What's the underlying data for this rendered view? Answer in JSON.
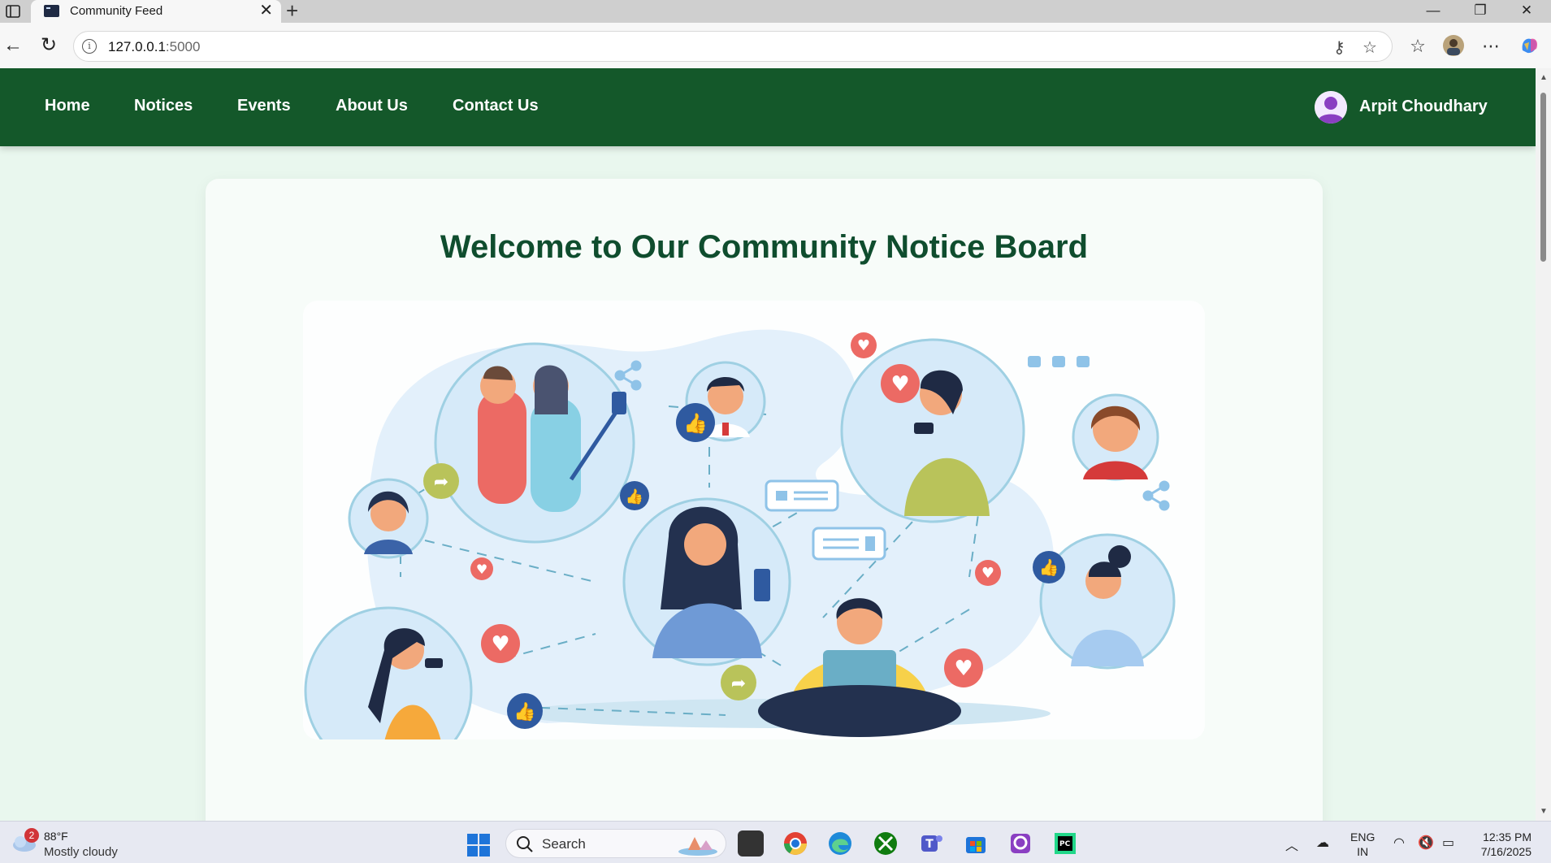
{
  "browser": {
    "tab_title": "Community Feed",
    "tab_close": "✕",
    "new_tab": "+",
    "url_host": "127.0.0.1",
    "url_port": ":5000",
    "info_glyph": "i"
  },
  "site": {
    "nav": [
      {
        "label": "Home"
      },
      {
        "label": "Notices"
      },
      {
        "label": "Events"
      },
      {
        "label": "About Us"
      },
      {
        "label": "Contact Us"
      }
    ],
    "user_name": "Arpit Choudhary",
    "welcome_title": "Welcome to Our Community Notice Board",
    "colors": {
      "nav_bg": "#14582a",
      "page_bg": "#e9f7ee",
      "title": "#0f4d2e"
    },
    "hero_icons": [
      "people-circle-illustration",
      "heart-icon",
      "thumbs-up-icon",
      "share-icon",
      "chat-bubble-icon",
      "laptop-icon"
    ]
  },
  "taskbar": {
    "weather_badge": "2",
    "weather_temp": "88°F",
    "weather_desc": "Mostly cloudy",
    "search_label": "Search",
    "lang_line1": "ENG",
    "lang_line2": "IN",
    "time": "12:35 PM",
    "date": "7/16/2025"
  }
}
